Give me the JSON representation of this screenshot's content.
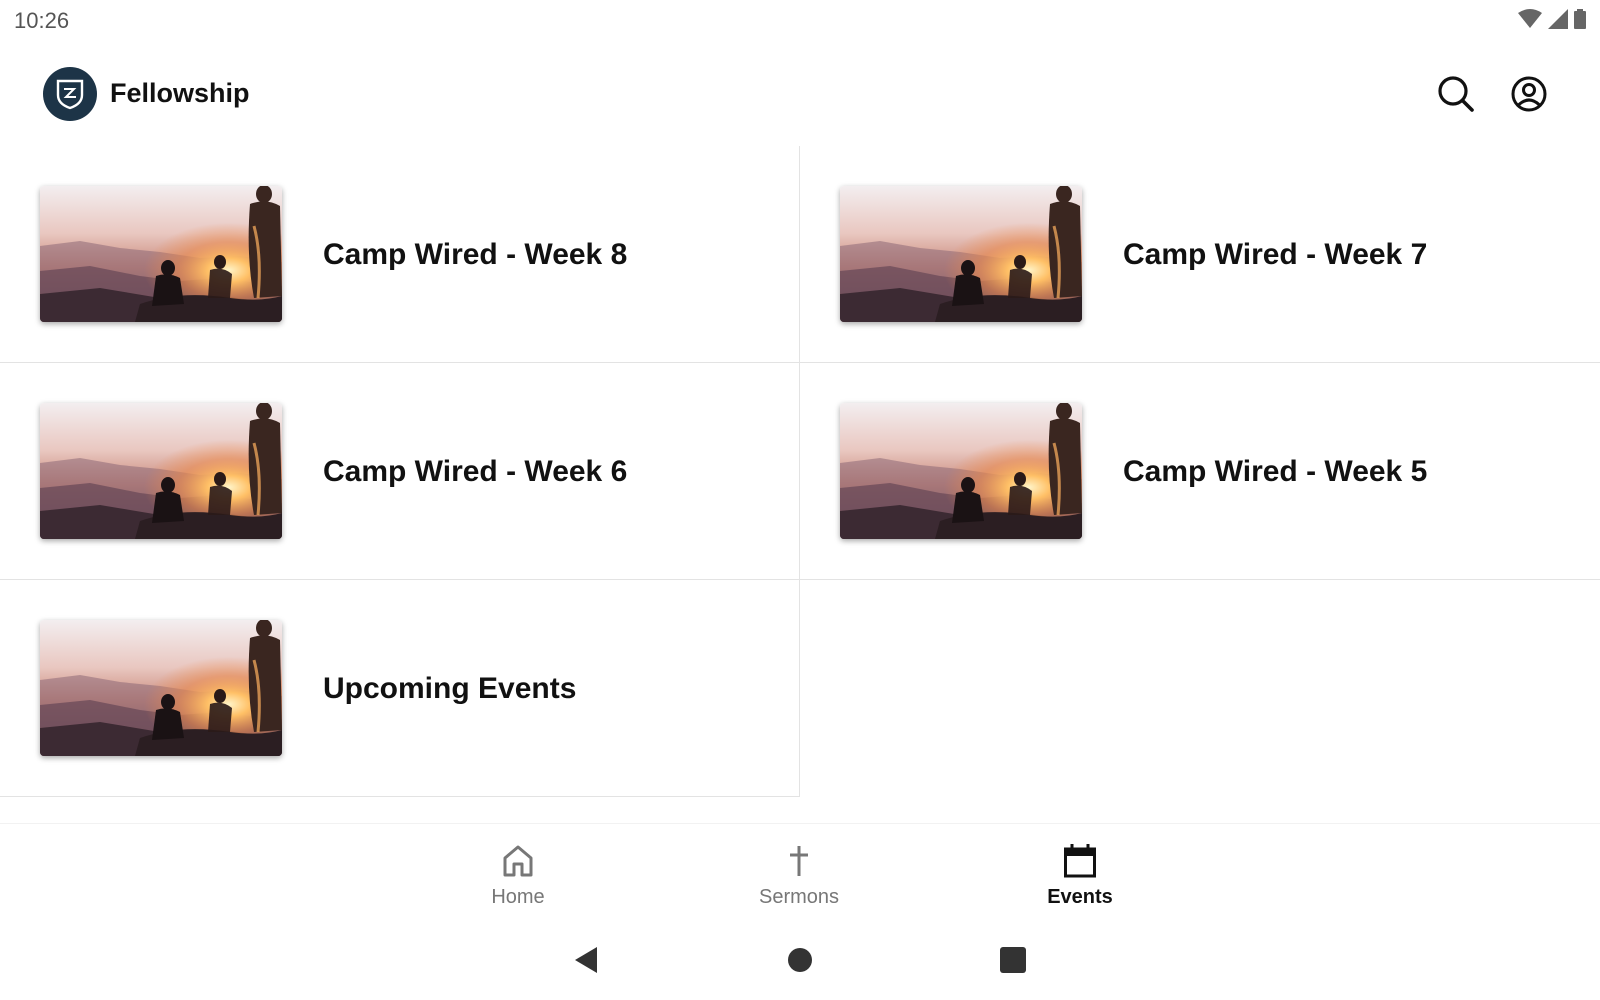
{
  "status_bar": {
    "time": "10:26"
  },
  "header": {
    "title": "Fellowship"
  },
  "events": [
    {
      "title": "Camp Wired - Week 8"
    },
    {
      "title": "Camp Wired - Week 7"
    },
    {
      "title": "Camp Wired - Week 6"
    },
    {
      "title": "Camp Wired - Week 5"
    },
    {
      "title": "Upcoming Events"
    }
  ],
  "bottom_nav": {
    "items": [
      {
        "label": "Home",
        "icon": "home-icon",
        "active": false
      },
      {
        "label": "Sermons",
        "icon": "cross-icon",
        "active": false
      },
      {
        "label": "Events",
        "icon": "calendar-icon",
        "active": true
      }
    ]
  },
  "colors": {
    "logo_bg": "#1d3447",
    "active_nav": "#111111",
    "inactive_nav": "#777777",
    "divider": "#e3e3e3"
  }
}
